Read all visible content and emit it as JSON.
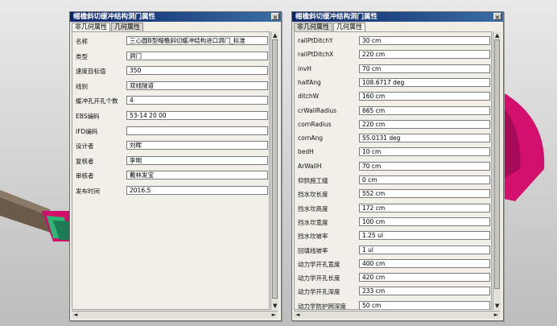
{
  "panel_left": {
    "title": "帽檐斜切缓冲结构洞门属性",
    "close_glyph": "×",
    "tabs": [
      "非几何属性",
      "几何属性"
    ],
    "rows": [
      {
        "label": "名称",
        "value": "三心圆B型帽檐斜切缓冲结构进口洞门_标准"
      },
      {
        "label": "类型",
        "value": "洞门"
      },
      {
        "label": "速度目标值",
        "value": "350"
      },
      {
        "label": "线别",
        "value": "双线隧道"
      },
      {
        "label": "缓冲孔开孔个数",
        "value": "4"
      },
      {
        "label": "EBS编码",
        "value": "53-14 20 00"
      },
      {
        "label": "IFD编码",
        "value": ""
      },
      {
        "label": "设计者",
        "value": "刘晖"
      },
      {
        "label": "复核者",
        "value": "李明"
      },
      {
        "label": "审核者",
        "value": "戴林发宝"
      },
      {
        "label": "发布时间",
        "value": "2016.5"
      }
    ]
  },
  "panel_right": {
    "title": "帽檐斜切缓冲结构洞门属性",
    "close_glyph": "×",
    "tabs": [
      "非几何属性",
      "几何属性"
    ],
    "rows": [
      {
        "label": "railPtDitchY",
        "value": "30 cm"
      },
      {
        "label": "railPtDitchX",
        "value": "220 cm"
      },
      {
        "label": "invH",
        "value": "70 cm"
      },
      {
        "label": "halfAng",
        "value": "108.6717 deg"
      },
      {
        "label": "ditchW",
        "value": "160 cm"
      },
      {
        "label": "crWallRadius",
        "value": "665 cm"
      },
      {
        "label": "cornRadius",
        "value": "220 cm"
      },
      {
        "label": "cornAng",
        "value": "55.0131 deg"
      },
      {
        "label": "bedH",
        "value": "10 cm"
      },
      {
        "label": "ArWallH",
        "value": "70 cm"
      },
      {
        "label": "仰拱施工缝",
        "value": "0 cm"
      },
      {
        "label": "挡水坎长度",
        "value": "552 cm"
      },
      {
        "label": "挡水坎高度",
        "value": "172 cm"
      },
      {
        "label": "挡水坎宽度",
        "value": "100 cm"
      },
      {
        "label": "挡水坎坡率",
        "value": "1.25 ul"
      },
      {
        "label": "回填线坡率",
        "value": "1 ul"
      },
      {
        "label": "动力学开孔宽度",
        "value": "400 cm"
      },
      {
        "label": "动力学开孔长度",
        "value": "420 cm"
      },
      {
        "label": "动力学开孔深度",
        "value": "233 cm"
      },
      {
        "label": "动力学防护网深度",
        "value": "50 cm"
      }
    ]
  },
  "colors": {
    "titlebar_start": "#0a246a",
    "titlebar_end": "#3a6ea5",
    "model_magenta": "#d4106e",
    "model_green": "#2bb673"
  }
}
